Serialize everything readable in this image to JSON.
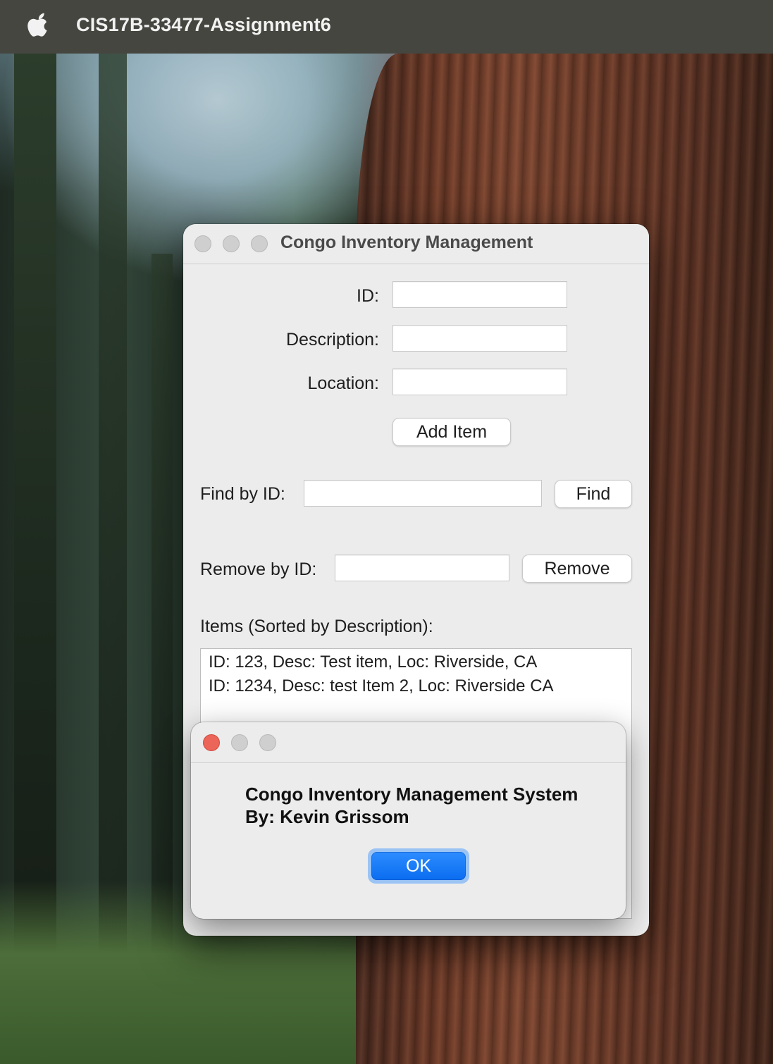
{
  "menubar": {
    "app_name": "CIS17B-33477-Assignment6",
    "apple_icon": "apple-logo-icon"
  },
  "main_window": {
    "title": "Congo Inventory Management",
    "form": {
      "id_label": "ID:",
      "id_value": "",
      "description_label": "Description:",
      "description_value": "",
      "location_label": "Location:",
      "location_value": "",
      "add_button": "Add Item"
    },
    "find": {
      "label": "Find by ID:",
      "value": "",
      "button": "Find"
    },
    "remove": {
      "label": "Remove by ID:",
      "value": "",
      "button": "Remove"
    },
    "items": {
      "label": "Items (Sorted by Description):",
      "rows": [
        "ID: 123, Desc: Test item, Loc: Riverside, CA",
        "ID: 1234, Desc: test Item 2, Loc: Riverside CA"
      ]
    }
  },
  "dialog": {
    "line1": "Congo Inventory Management System",
    "line2": "By: Kevin Grissom",
    "ok_button": "OK"
  },
  "colors": {
    "menubar": "#45463f",
    "window_bg": "#ececec",
    "close_button": "#ec6559",
    "accent_blue": "#0a6df0"
  }
}
